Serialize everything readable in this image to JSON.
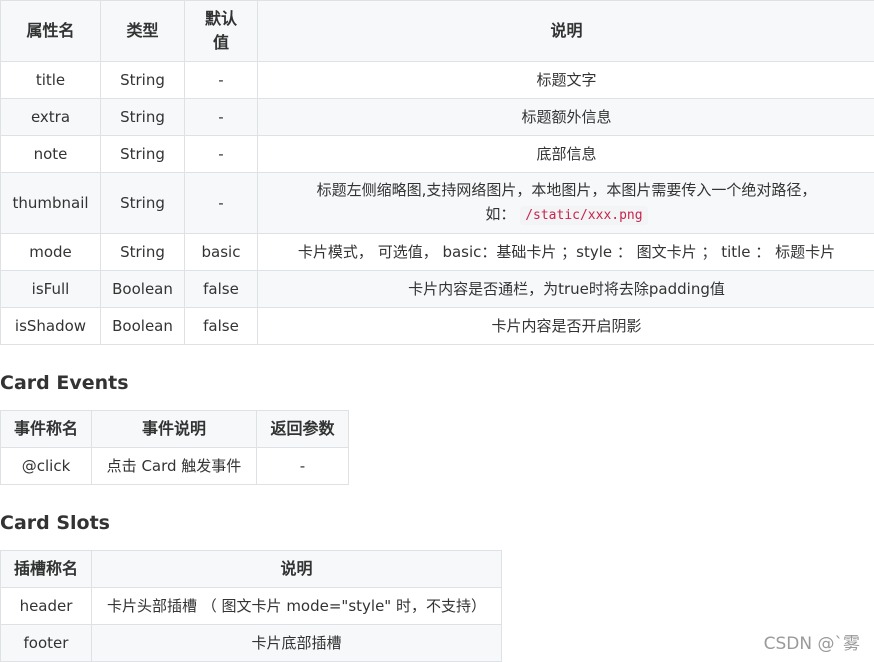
{
  "props_table": {
    "headers": [
      "属性名",
      "类型",
      "默认值",
      "说明"
    ],
    "rows": [
      {
        "name": "title",
        "type": "String",
        "default": "-",
        "desc": "标题文字"
      },
      {
        "name": "extra",
        "type": "String",
        "default": "-",
        "desc": "标题额外信息"
      },
      {
        "name": "note",
        "type": "String",
        "default": "-",
        "desc": "底部信息"
      },
      {
        "name": "thumbnail",
        "type": "String",
        "default": "-",
        "desc": "标题左侧缩略图,支持网络图片，本地图片，本图片需要传入一个绝对路径，",
        "desc2": "如：",
        "code": "/static/xxx.png"
      },
      {
        "name": "mode",
        "type": "String",
        "default": "basic",
        "desc": "卡片模式， 可选值， basic：基础卡片 ；style ： 图文卡片 ； title ： 标题卡片"
      },
      {
        "name": "isFull",
        "type": "Boolean",
        "default": "false",
        "desc": "卡片内容是否通栏，为true时将去除padding值"
      },
      {
        "name": "isShadow",
        "type": "Boolean",
        "default": "false",
        "desc": "卡片内容是否开启阴影"
      }
    ]
  },
  "events_section": {
    "title": "Card Events",
    "headers": [
      "事件称名",
      "事件说明",
      "返回参数"
    ],
    "rows": [
      {
        "name": "@click",
        "desc": "点击 Card 触发事件",
        "ret": "-"
      }
    ]
  },
  "slots_section": {
    "title": "Card Slots",
    "headers": [
      "插槽称名",
      "说明"
    ],
    "rows": [
      {
        "name": "header",
        "desc": "卡片头部插槽 （ 图文卡片 mode=\"style\" 时，不支持）"
      },
      {
        "name": "footer",
        "desc": "卡片底部插槽"
      }
    ]
  },
  "watermark": "CSDN @ˋ雾"
}
